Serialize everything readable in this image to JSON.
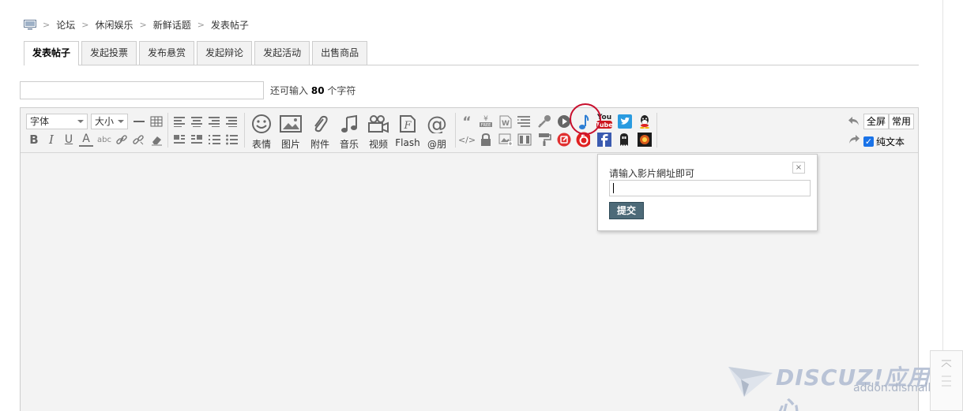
{
  "breadcrumb": {
    "home_icon": "monitor-icon",
    "items": [
      "论坛",
      "休闲娱乐",
      "新鲜话题",
      "发表帖子"
    ]
  },
  "tabs": [
    "发表帖子",
    "发起投票",
    "发布悬赏",
    "发起辩论",
    "发起活动",
    "出售商品"
  ],
  "title_field": {
    "value": "",
    "counter_prefix": "还可输入",
    "counter_value": "80",
    "counter_suffix": "个字符"
  },
  "toolbar": {
    "font_select": "字体",
    "size_select": "大小",
    "big_buttons": [
      "表情",
      "图片",
      "附件",
      "音乐",
      "视频",
      "Flash",
      "@朋"
    ],
    "fullscreen": "全屏",
    "common": "常用",
    "plain_text": "纯文本",
    "youtube_text_top": "You",
    "youtube_text_bottom": "Tube"
  },
  "popup": {
    "prompt": "请输入影片網址即可",
    "input_value": "",
    "submit": "提交",
    "close": "×"
  },
  "watermark": {
    "brand": "DISCUZ!应用中心",
    "url": "addon.dismall.com"
  },
  "colors": {
    "highlight_circle": "#c8102e",
    "submit_bg": "#4d6a78",
    "checkbox": "#1a73e8",
    "youtube_red": "#cc181e"
  }
}
